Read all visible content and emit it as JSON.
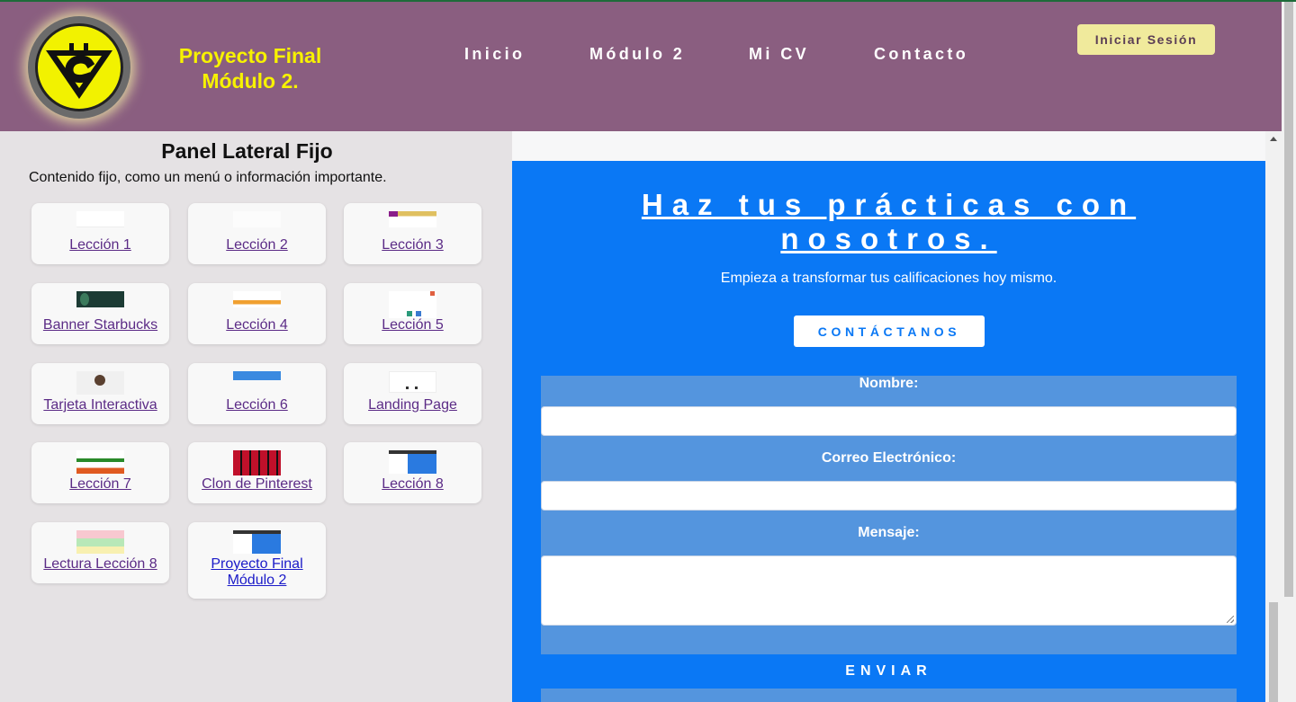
{
  "header": {
    "brand": [
      "Proyecto Final",
      "Módulo 2."
    ],
    "logo_icon": "bitcoin-logo-icon",
    "nav": [
      "Inicio",
      "Módulo 2",
      "Mi CV",
      "Contacto"
    ],
    "login_label": "Iniciar Sesión"
  },
  "sidebar": {
    "title": "Panel Lateral Fijo",
    "description": "Contenido fijo, como un menú o información importante.",
    "cards": [
      {
        "label": "Lección 1"
      },
      {
        "label": "Lección 2"
      },
      {
        "label": "Lección 3"
      },
      {
        "label": "Banner Starbucks"
      },
      {
        "label": "Lección 4"
      },
      {
        "label": "Lección 5"
      },
      {
        "label": "Tarjeta Interactiva"
      },
      {
        "label": "Lección 6"
      },
      {
        "label": "Landing Page"
      },
      {
        "label": "Lección 7"
      },
      {
        "label": "Clon de Pinterest"
      },
      {
        "label": "Lección 8"
      },
      {
        "label": "Lectura Lección 8"
      },
      {
        "label": "Proyecto Final Módulo 2"
      }
    ]
  },
  "main": {
    "hero_title": "Haz tus prácticas con nosotros.",
    "hero_subtitle": "Empieza a transformar tus calificaciones hoy mismo.",
    "cta_label": "CONTÁCTANOS",
    "form": {
      "name_label": "Nombre:",
      "email_label": "Correo Electrónico:",
      "message_label": "Mensaje:",
      "submit_label": "ENVIAR"
    }
  },
  "colors": {
    "header_bg": "#8a5e80",
    "brand_text": "#f7f200",
    "main_bg": "#0a78f5",
    "form_bg": "#5495de",
    "sidebar_bg": "#e5e2e4"
  }
}
